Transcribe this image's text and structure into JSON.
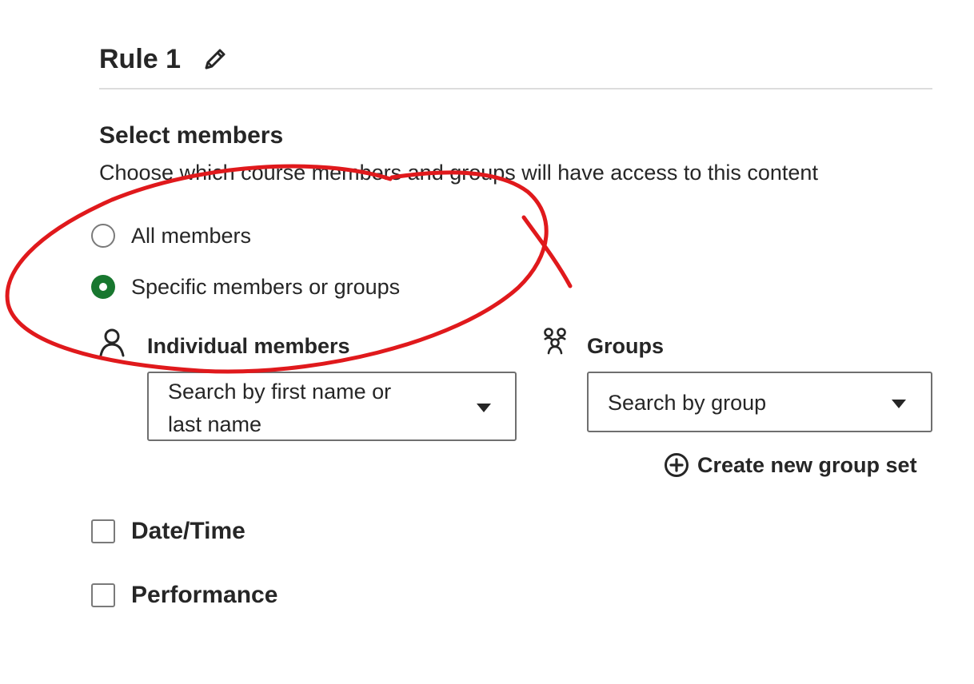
{
  "rule": {
    "title": "Rule 1",
    "edit_icon": "pencil-icon"
  },
  "select_members": {
    "title": "Select members",
    "description": "Choose which course members and groups will have access to this content",
    "options": [
      {
        "label": "All members",
        "checked": false
      },
      {
        "label": "Specific members or groups",
        "checked": true
      }
    ]
  },
  "individual_members": {
    "icon": "person-icon",
    "label": "Individual members",
    "placeholder_line1": "Search by first name or",
    "placeholder_line2": "last name"
  },
  "groups": {
    "icon": "group-icon",
    "label": "Groups",
    "placeholder": "Search by group",
    "create_icon": "plus-circle-icon",
    "create_label": "Create new group set"
  },
  "conditions": [
    {
      "label": "Date/Time",
      "checked": false
    },
    {
      "label": "Performance",
      "checked": false
    }
  ],
  "colors": {
    "accent_green": "#18772f",
    "annotation_red": "#e0191c",
    "text": "#262626"
  }
}
